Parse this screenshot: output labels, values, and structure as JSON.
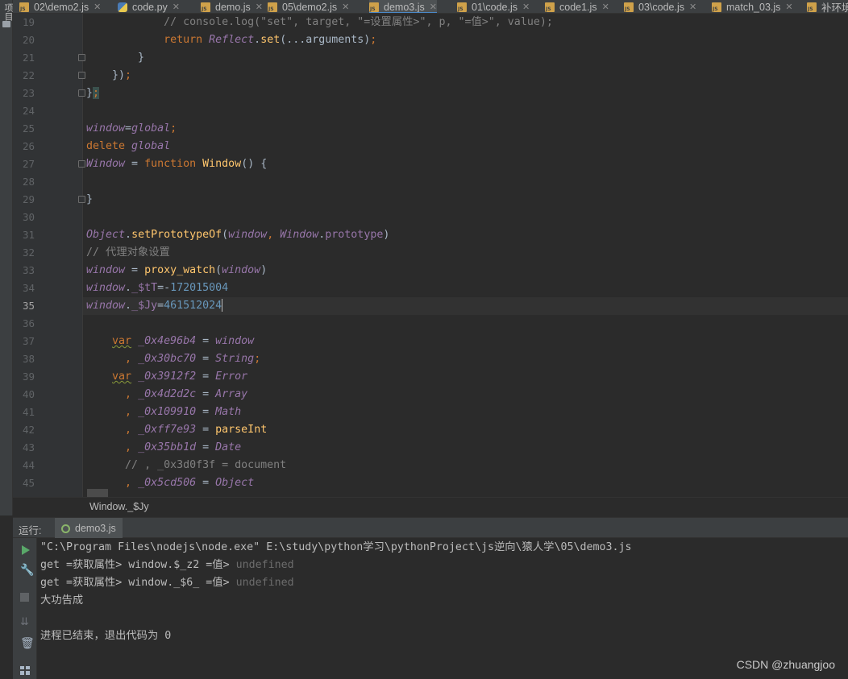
{
  "left_strip": {
    "label": "项目"
  },
  "tabs": [
    {
      "name": "02\\demo2.js",
      "icon": "js-file-icon"
    },
    {
      "name": "code.py",
      "icon": "python-file-icon"
    },
    {
      "name": "demo.js",
      "icon": "js-file-icon"
    },
    {
      "name": "05\\demo2.js",
      "icon": "js-file-icon"
    },
    {
      "name": "demo3.js",
      "icon": "js-file-icon",
      "active": true
    },
    {
      "name": "01\\code.js",
      "icon": "js-file-icon"
    },
    {
      "name": "code1.js",
      "icon": "js-file-icon"
    },
    {
      "name": "03\\code.js",
      "icon": "js-file-icon"
    },
    {
      "name": "match_03.js",
      "icon": "js-file-icon"
    },
    {
      "name": "补环境",
      "icon": "js-file-icon"
    }
  ],
  "editor": {
    "current_line": 35,
    "lines": [
      {
        "num": "19",
        "t": [
          [
            "plain",
            "            "
          ],
          [
            "cm",
            "// console.log(\"set\", target, \"=设置属性>\", p, \"=值>\", value);"
          ]
        ]
      },
      {
        "num": "20",
        "t": [
          [
            "plain",
            "            "
          ],
          [
            "kw",
            "return "
          ],
          [
            "gl",
            "Reflect"
          ],
          [
            "plain",
            "."
          ],
          [
            "fn",
            "set"
          ],
          [
            "plain",
            "(...arguments)"
          ],
          [
            "kw",
            ";"
          ]
        ]
      },
      {
        "num": "21",
        "t": [
          [
            "plain",
            "        }"
          ]
        ]
      },
      {
        "num": "22",
        "t": [
          [
            "plain",
            "    })"
          ],
          [
            "kw",
            ";"
          ]
        ]
      },
      {
        "num": "23",
        "t": [
          [
            "plain",
            "}"
          ],
          [
            "kw",
            ";"
          ]
        ]
      },
      {
        "num": "24",
        "t": []
      },
      {
        "num": "25",
        "t": [
          [
            "gl",
            "window"
          ],
          [
            "plain",
            "="
          ],
          [
            "gl",
            "global"
          ],
          [
            "kw",
            ";"
          ]
        ]
      },
      {
        "num": "26",
        "t": [
          [
            "kw",
            "delete "
          ],
          [
            "gl",
            "global"
          ]
        ]
      },
      {
        "num": "27",
        "t": [
          [
            "gl",
            "Window"
          ],
          [
            "plain",
            " = "
          ],
          [
            "kw",
            "function "
          ],
          [
            "fn",
            "Window"
          ],
          [
            "plain",
            "() {"
          ]
        ]
      },
      {
        "num": "28",
        "t": []
      },
      {
        "num": "29",
        "t": [
          [
            "plain",
            "}"
          ]
        ]
      },
      {
        "num": "30",
        "t": []
      },
      {
        "num": "31",
        "t": [
          [
            "gl",
            "Object"
          ],
          [
            "plain",
            "."
          ],
          [
            "fn",
            "setPrototypeOf"
          ],
          [
            "plain",
            "("
          ],
          [
            "gl",
            "window"
          ],
          [
            "kw",
            ", "
          ],
          [
            "gl",
            "Window"
          ],
          [
            "plain",
            "."
          ],
          [
            "prop",
            "prototype"
          ],
          [
            "plain",
            ")"
          ]
        ]
      },
      {
        "num": "32",
        "t": [
          [
            "cm",
            "// 代理对象设置"
          ]
        ]
      },
      {
        "num": "33",
        "t": [
          [
            "gl",
            "window"
          ],
          [
            "plain",
            " = "
          ],
          [
            "fn",
            "proxy_watch"
          ],
          [
            "plain",
            "("
          ],
          [
            "gl",
            "window"
          ],
          [
            "plain",
            ")"
          ]
        ]
      },
      {
        "num": "34",
        "t": [
          [
            "gl",
            "window"
          ],
          [
            "plain",
            "."
          ],
          [
            "prop",
            "_$tT"
          ],
          [
            "plain",
            "=-"
          ],
          [
            "num",
            "172015004"
          ]
        ]
      },
      {
        "num": "35",
        "t": [
          [
            "gl",
            "window"
          ],
          [
            "plain",
            "."
          ],
          [
            "prop",
            "_$Jy"
          ],
          [
            "plain",
            "="
          ],
          [
            "num",
            "461512024"
          ]
        ]
      },
      {
        "num": "36",
        "t": []
      },
      {
        "num": "37",
        "t": [
          [
            "plain",
            "    "
          ],
          [
            "kw squig",
            "var"
          ],
          [
            "gl",
            " _0x4e96b4"
          ],
          [
            "plain",
            " = "
          ],
          [
            "gl",
            "window"
          ]
        ]
      },
      {
        "num": "38",
        "t": [
          [
            "plain",
            "      "
          ],
          [
            "kw",
            ", "
          ],
          [
            "gl",
            "_0x30bc70"
          ],
          [
            "plain",
            " = "
          ],
          [
            "gl",
            "String"
          ],
          [
            "kw",
            ";"
          ]
        ]
      },
      {
        "num": "39",
        "t": [
          [
            "plain",
            "    "
          ],
          [
            "kw squig",
            "var"
          ],
          [
            "gl",
            " _0x3912f2"
          ],
          [
            "plain",
            " = "
          ],
          [
            "gl",
            "Error"
          ]
        ]
      },
      {
        "num": "40",
        "t": [
          [
            "plain",
            "      "
          ],
          [
            "kw",
            ", "
          ],
          [
            "gl",
            "_0x4d2d2c"
          ],
          [
            "plain",
            " = "
          ],
          [
            "gl",
            "Array"
          ]
        ]
      },
      {
        "num": "41",
        "t": [
          [
            "plain",
            "      "
          ],
          [
            "kw",
            ", "
          ],
          [
            "gl",
            "_0x109910"
          ],
          [
            "plain",
            " = "
          ],
          [
            "gl",
            "Math"
          ]
        ]
      },
      {
        "num": "42",
        "t": [
          [
            "plain",
            "      "
          ],
          [
            "kw",
            ", "
          ],
          [
            "gl",
            "_0xff7e93"
          ],
          [
            "plain",
            " = "
          ],
          [
            "fn",
            "parseInt"
          ]
        ]
      },
      {
        "num": "43",
        "t": [
          [
            "plain",
            "      "
          ],
          [
            "kw",
            ", "
          ],
          [
            "gl",
            "_0x35bb1d"
          ],
          [
            "plain",
            " = "
          ],
          [
            "gl",
            "Date"
          ]
        ]
      },
      {
        "num": "44",
        "t": [
          [
            "plain",
            "      "
          ],
          [
            "cm",
            "// , _0x3d0f3f = document"
          ]
        ]
      },
      {
        "num": "45",
        "t": [
          [
            "plain",
            "      "
          ],
          [
            "kw",
            ", "
          ],
          [
            "gl",
            "_0x5cd506"
          ],
          [
            "plain",
            " = "
          ],
          [
            "gl",
            "Object"
          ]
        ]
      }
    ]
  },
  "breadcrumb": {
    "text": "Window._$Jy"
  },
  "run_panel": {
    "label": "运行:",
    "tab": "demo3.js",
    "output": [
      {
        "text": "\"C:\\Program Files\\nodejs\\node.exe\" E:\\study\\python学习\\pythonProject\\js逆向\\猿人学\\05\\demo3.js"
      },
      {
        "text": "get =获取属性> window.$_z2 =值> ",
        "dim": "undefined"
      },
      {
        "text": "get =获取属性> window._$6_ =值> ",
        "dim": "undefined"
      },
      {
        "text": "大功告成"
      },
      {
        "text": ""
      },
      {
        "text": "进程已结束，退出代码为 0"
      }
    ]
  },
  "watermark": "CSDN @zhuangjoo",
  "colors": {
    "keyword": "#cc7832",
    "global": "#9876aa",
    "function": "#ffc66d",
    "number": "#6897bb",
    "comment": "#808080",
    "active_tab_underline": "#4a88c7"
  }
}
